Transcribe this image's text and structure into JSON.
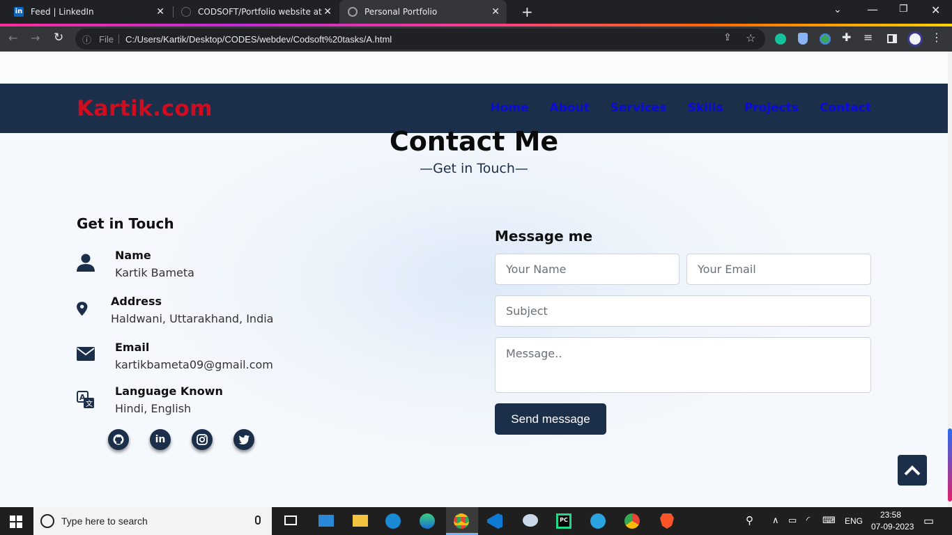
{
  "browser": {
    "tabs": [
      {
        "title": "Feed | LinkedIn",
        "close": "✕"
      },
      {
        "title": "CODSOFT/Portfolio website at m",
        "close": "✕"
      },
      {
        "title": "Personal Portfolio",
        "close": "✕"
      }
    ],
    "new_tab": "+",
    "file_label": "File",
    "url": "C:/Users/Kartik/Desktop/CODES/webdev/Codsoft%20tasks/A.html"
  },
  "site": {
    "logo": "Kartik.com",
    "nav": [
      "Home",
      "About",
      "Services",
      "Skills",
      "Projects",
      "Contact"
    ]
  },
  "contact": {
    "title": "Contact Me",
    "subtitle": "—Get in Touch—",
    "left_heading": "Get in Touch",
    "items": [
      {
        "label": "Name",
        "value": "Kartik Bameta",
        "icon": "user-icon"
      },
      {
        "label": "Address",
        "value": "Haldwani, Uttarakhand, India",
        "icon": "map-pin-icon"
      },
      {
        "label": "Email",
        "value": "kartikbameta09@gmail.com",
        "icon": "envelope-icon"
      },
      {
        "label": "Language Known",
        "value": "Hindi, English",
        "icon": "language-icon"
      }
    ],
    "socials": [
      "github-icon",
      "linkedin-icon",
      "instagram-icon",
      "twitter-icon"
    ],
    "form": {
      "heading": "Message me",
      "name_placeholder": "Your Name",
      "email_placeholder": "Your Email",
      "subject_placeholder": "Subject",
      "message_placeholder": "Message..",
      "send_label": "Send message"
    }
  },
  "taskbar": {
    "search_placeholder": "Type here to search",
    "lang": "ENG",
    "time": "23:58",
    "date": "07-09-2023"
  }
}
